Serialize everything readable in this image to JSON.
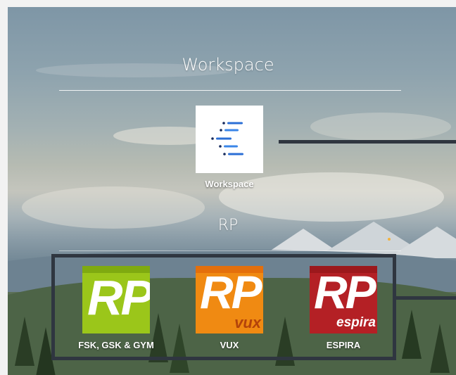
{
  "sections": [
    {
      "title": "Workspace",
      "apps": [
        {
          "label": "Workspace",
          "icon": "workspace-bullets-icon"
        }
      ]
    },
    {
      "title": "RP",
      "apps": [
        {
          "label": "FSK, GSK & GYM",
          "icon": "rp-green-logo",
          "logo_text": "RP",
          "color": "#9bc61a"
        },
        {
          "label": "VUX",
          "icon": "rp-vux-orange-logo",
          "logo_text": "RP",
          "sub_text": "vux",
          "color": "#f08a12"
        },
        {
          "label": "ESPIRA",
          "icon": "rp-espira-red-logo",
          "logo_text": "RP",
          "sub_text": "espira",
          "color": "#b42025"
        }
      ]
    }
  ],
  "colors": {
    "highlight_border": "#2f3640",
    "workspace_icon_blue": "#2b6fd6",
    "workspace_icon_navy": "#152a5c"
  }
}
